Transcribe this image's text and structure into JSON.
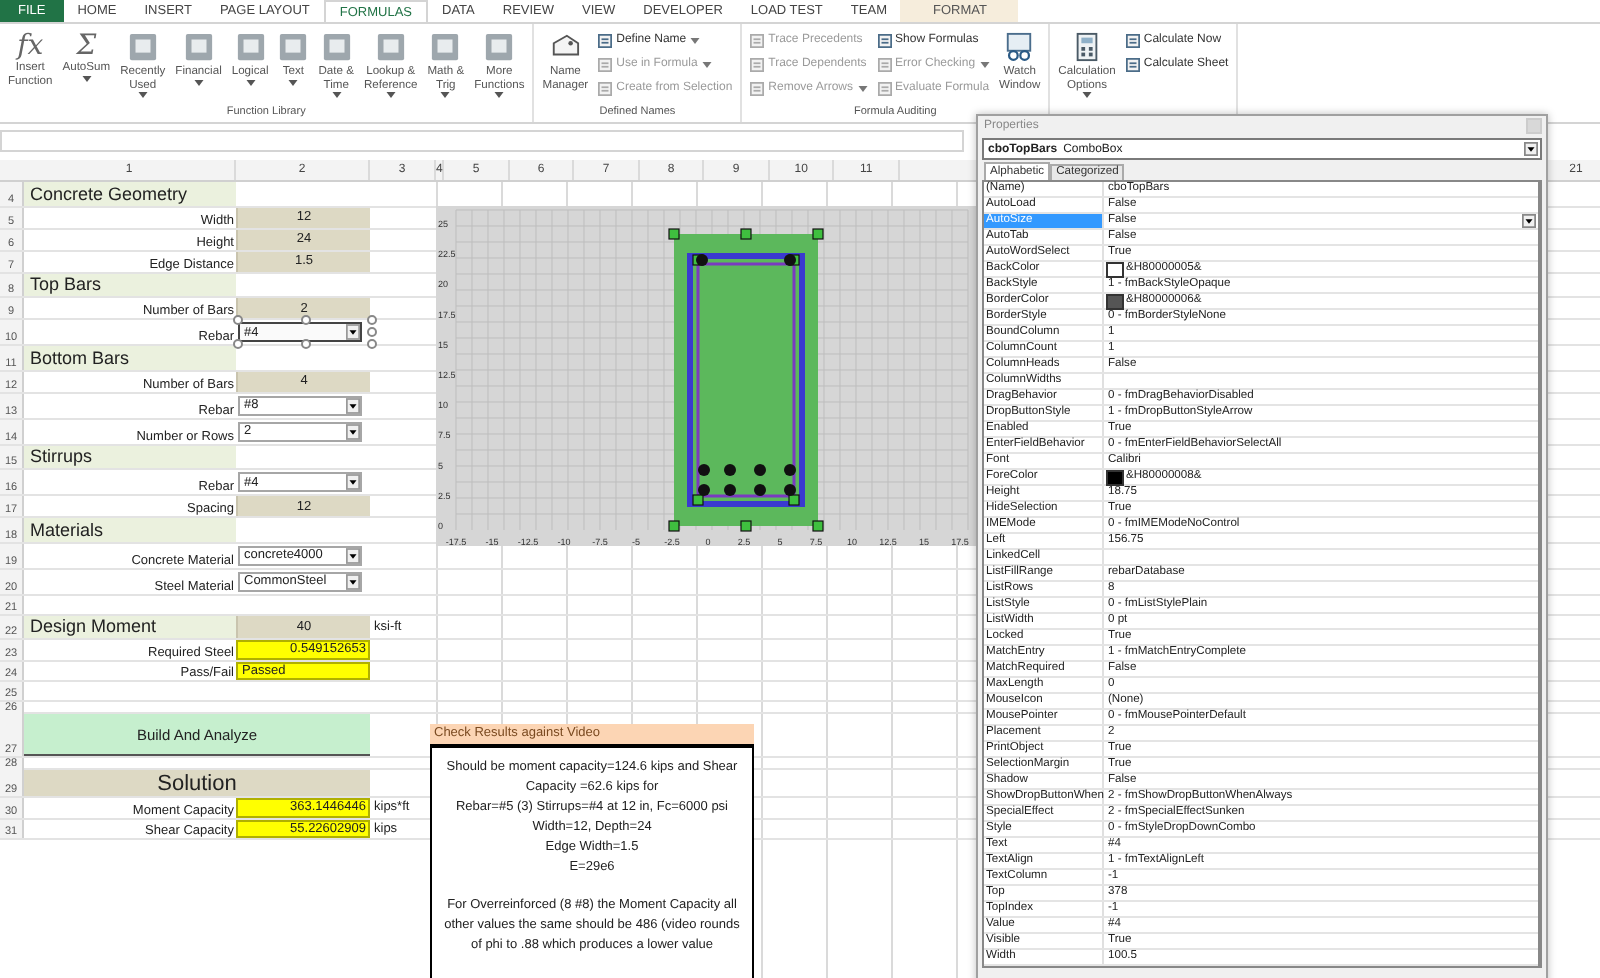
{
  "ribbon_tabs": [
    {
      "label": "FILE",
      "kind": "file",
      "selected": false
    },
    {
      "label": "HOME",
      "kind": "tab",
      "selected": false
    },
    {
      "label": "INSERT",
      "kind": "tab",
      "selected": false
    },
    {
      "label": "PAGE LAYOUT",
      "kind": "tab",
      "selected": false
    },
    {
      "label": "FORMULAS",
      "kind": "tab",
      "selected": true
    },
    {
      "label": "DATA",
      "kind": "tab",
      "selected": false
    },
    {
      "label": "REVIEW",
      "kind": "tab",
      "selected": false
    },
    {
      "label": "VIEW",
      "kind": "tab",
      "selected": false
    },
    {
      "label": "DEVELOPER",
      "kind": "tab",
      "selected": false
    },
    {
      "label": "LOAD TEST",
      "kind": "tab",
      "selected": false
    },
    {
      "label": "TEAM",
      "kind": "tab",
      "selected": false
    },
    {
      "label": "FORMAT",
      "kind": "contextual",
      "selected": false
    }
  ],
  "ribbon_groups": [
    {
      "label": "Function Library",
      "items": [
        {
          "kind": "large",
          "glyph": "fx",
          "lines": [
            "Insert",
            "Function"
          ],
          "dropdown": false
        },
        {
          "kind": "large",
          "glyph": "Σ",
          "lines": [
            "AutoSum"
          ],
          "dropdown": true
        },
        {
          "kind": "large",
          "lines": [
            "Recently",
            "Used"
          ],
          "dropdown": true
        },
        {
          "kind": "large",
          "lines": [
            "Financial"
          ],
          "dropdown": true
        },
        {
          "kind": "large",
          "lines": [
            "Logical"
          ],
          "dropdown": true
        },
        {
          "kind": "large",
          "lines": [
            "Text"
          ],
          "dropdown": true
        },
        {
          "kind": "large",
          "lines": [
            "Date &",
            "Time"
          ],
          "dropdown": true
        },
        {
          "kind": "large",
          "lines": [
            "Lookup &",
            "Reference"
          ],
          "dropdown": true
        },
        {
          "kind": "large",
          "lines": [
            "Math &",
            "Trig"
          ],
          "dropdown": true
        },
        {
          "kind": "large",
          "lines": [
            "More",
            "Functions"
          ],
          "dropdown": true
        }
      ]
    },
    {
      "label": "Defined Names",
      "items": [
        {
          "kind": "large",
          "lines": [
            "Name",
            "Manager"
          ],
          "dropdown": false
        },
        {
          "kind": "stack",
          "buttons": [
            {
              "label": "Define Name",
              "dropdown": true,
              "disabled": false
            },
            {
              "label": "Use in Formula",
              "dropdown": true,
              "disabled": true
            },
            {
              "label": "Create from Selection",
              "dropdown": false,
              "disabled": true
            }
          ]
        }
      ]
    },
    {
      "label": "Formula Auditing",
      "items": [
        {
          "kind": "stack",
          "buttons": [
            {
              "label": "Trace Precedents",
              "dropdown": false,
              "disabled": true
            },
            {
              "label": "Trace Dependents",
              "dropdown": false,
              "disabled": true
            },
            {
              "label": "Remove Arrows",
              "dropdown": true,
              "disabled": true
            }
          ]
        },
        {
          "kind": "stack",
          "buttons": [
            {
              "label": "Show Formulas",
              "dropdown": false,
              "disabled": false
            },
            {
              "label": "Error Checking",
              "dropdown": true,
              "disabled": true
            },
            {
              "label": "Evaluate Formula",
              "dropdown": false,
              "disabled": true
            }
          ]
        },
        {
          "kind": "large",
          "lines": [
            "Watch",
            "Window"
          ],
          "dropdown": false
        }
      ]
    },
    {
      "items": [
        {
          "kind": "large",
          "lines": [
            "Calculation",
            "Options"
          ],
          "dropdown": true
        },
        {
          "kind": "stack",
          "buttons": [
            {
              "label": "Calculate Now",
              "dropdown": false,
              "disabled": false
            },
            {
              "label": "Calculate Sheet",
              "dropdown": false,
              "disabled": false
            }
          ]
        }
      ]
    }
  ],
  "column_headers": [
    "1",
    "2",
    "3",
    "4",
    "5",
    "6",
    "7",
    "8",
    "9",
    "10",
    "11"
  ],
  "far_column_header": "21",
  "sheet_rows": [
    {
      "row": "4",
      "kind": "section",
      "label": "Concrete Geometry"
    },
    {
      "row": "5",
      "kind": "value",
      "label": "Width",
      "value": "12"
    },
    {
      "row": "6",
      "kind": "value",
      "label": "Height",
      "value": "24"
    },
    {
      "row": "7",
      "kind": "value",
      "label": "Edge Distance",
      "value": "1.5"
    },
    {
      "row": "8",
      "kind": "section",
      "label": "Top Bars"
    },
    {
      "row": "9",
      "kind": "value",
      "label": "Number of Bars",
      "value": "2"
    },
    {
      "row": "10",
      "kind": "combo",
      "label": "Rebar",
      "value": "#4",
      "selected": true
    },
    {
      "row": "11",
      "kind": "section",
      "label": "Bottom Bars"
    },
    {
      "row": "12",
      "kind": "value",
      "label": "Number of Bars",
      "value": "4"
    },
    {
      "row": "13",
      "kind": "combo",
      "label": "Rebar",
      "value": "#8",
      "selected": false
    },
    {
      "row": "14",
      "kind": "combo",
      "label": "Number or Rows",
      "value": "2",
      "selected": false
    },
    {
      "row": "15",
      "kind": "section",
      "label": "Stirrups"
    },
    {
      "row": "16",
      "kind": "combo",
      "label": "Rebar",
      "value": "#4",
      "selected": false
    },
    {
      "row": "17",
      "kind": "value",
      "label": "Spacing",
      "value": "12"
    },
    {
      "row": "18",
      "kind": "section",
      "label": "Materials"
    },
    {
      "row": "19",
      "kind": "combo",
      "label": "Concrete Material",
      "value": "concrete4000",
      "selected": false
    },
    {
      "row": "20",
      "kind": "combo",
      "label": "Steel Material",
      "value": "CommonSteel",
      "selected": false
    },
    {
      "row": "21",
      "kind": "blank"
    },
    {
      "row": "22",
      "kind": "heading_value",
      "label": "Design Moment",
      "value": "40",
      "unit": "ksi-ft"
    },
    {
      "row": "23",
      "kind": "result",
      "label": "Required Steel",
      "value": "0.549152653"
    },
    {
      "row": "24",
      "kind": "result_text",
      "label": "Pass/Fail",
      "value": "Passed"
    },
    {
      "row": "25",
      "kind": "blank"
    },
    {
      "row": "26",
      "kind": "spacer"
    },
    {
      "row": "27",
      "kind": "button",
      "label": "Build And Analyze"
    },
    {
      "row": "28",
      "kind": "spacer"
    },
    {
      "row": "29",
      "kind": "solution",
      "label": "Solution"
    },
    {
      "row": "30",
      "kind": "result",
      "label": "Moment Capacity",
      "value": "363.1446446",
      "unit": "kips*ft"
    },
    {
      "row": "31",
      "kind": "result",
      "label": "Shear Capacity",
      "value": "55.22602909",
      "unit": "kips"
    }
  ],
  "section_drawing": {
    "y_labels": [
      "25",
      "22.5",
      "20",
      "17.5",
      "15",
      "12.5",
      "10",
      "7.5",
      "5",
      "2.5",
      "0"
    ],
    "x_labels": [
      "-17.5",
      "-15",
      "-12.5",
      "-10",
      "-7.5",
      "-5",
      "-2.5",
      "0",
      "2.5",
      "5",
      "7.5",
      "10",
      "12.5",
      "15",
      "17.5"
    ]
  },
  "check_box": {
    "title": "Check Results against Video",
    "blocks": [
      [
        "Should be moment capacity=124.6  kips and Shear Capacity =62.6 kips  for",
        "Rebar=#5 (3)  Stirrups=#4 at 12 in, Fc=6000 psi",
        "Width=12, Depth=24",
        "Edge Width=1.5",
        "E=29e6"
      ],
      [
        "For Overreinforced  (8 #8) the  Moment Capacity all other values the same  should be 486 (video rounds of phi to .88 which produces a lower value"
      ]
    ]
  },
  "properties": {
    "title": "Properties",
    "object_name": "cboTopBars",
    "object_type": "ComboBox",
    "tabs": [
      {
        "label": "Alphabetic",
        "selected": true
      },
      {
        "label": "Categorized",
        "selected": false
      }
    ],
    "rows": [
      {
        "name": "(Name)",
        "value": "cboTopBars",
        "selected": false
      },
      {
        "name": "AutoLoad",
        "value": "False",
        "selected": false
      },
      {
        "name": "AutoSize",
        "value": "False",
        "selected": true
      },
      {
        "name": "AutoTab",
        "value": "False",
        "selected": false
      },
      {
        "name": "AutoWordSelect",
        "value": "True",
        "selected": false
      },
      {
        "name": "BackColor",
        "value": "&H80000005&",
        "color": "#ffffff",
        "selected": false
      },
      {
        "name": "BackStyle",
        "value": "1 - fmBackStyleOpaque",
        "selected": false
      },
      {
        "name": "BorderColor",
        "value": "&H80000006&",
        "color": "#555555",
        "selected": false
      },
      {
        "name": "BorderStyle",
        "value": "0 - fmBorderStyleNone",
        "selected": false
      },
      {
        "name": "BoundColumn",
        "value": "1",
        "selected": false
      },
      {
        "name": "ColumnCount",
        "value": "1",
        "selected": false
      },
      {
        "name": "ColumnHeads",
        "value": "False",
        "selected": false
      },
      {
        "name": "ColumnWidths",
        "selected": false
      },
      {
        "name": "DragBehavior",
        "value": "0 - fmDragBehaviorDisabled",
        "selected": false
      },
      {
        "name": "DropButtonStyle",
        "value": "1 - fmDropButtonStyleArrow",
        "selected": false
      },
      {
        "name": "Enabled",
        "value": "True",
        "selected": false
      },
      {
        "name": "EnterFieldBehavior",
        "value": "0 - fmEnterFieldBehaviorSelectAll",
        "selected": false
      },
      {
        "name": "Font",
        "value": "Calibri",
        "selected": false
      },
      {
        "name": "ForeColor",
        "value": "&H80000008&",
        "color": "#000000",
        "selected": false
      },
      {
        "name": "Height",
        "value": "18.75",
        "selected": false
      },
      {
        "name": "HideSelection",
        "value": "True",
        "selected": false
      },
      {
        "name": "IMEMode",
        "value": "0 - fmIMEModeNoControl",
        "selected": false
      },
      {
        "name": "Left",
        "value": "156.75",
        "selected": false
      },
      {
        "name": "LinkedCell",
        "selected": false
      },
      {
        "name": "ListFillRange",
        "value": "rebarDatabase",
        "selected": false
      },
      {
        "name": "ListRows",
        "value": "8",
        "selected": false
      },
      {
        "name": "ListStyle",
        "value": "0 - fmListStylePlain",
        "selected": false
      },
      {
        "name": "ListWidth",
        "value": "0 pt",
        "selected": false
      },
      {
        "name": "Locked",
        "value": "True",
        "selected": false
      },
      {
        "name": "MatchEntry",
        "value": "1 - fmMatchEntryComplete",
        "selected": false
      },
      {
        "name": "MatchRequired",
        "value": "False",
        "selected": false
      },
      {
        "name": "MaxLength",
        "value": "0",
        "selected": false
      },
      {
        "name": "MouseIcon",
        "value": "(None)",
        "selected": false
      },
      {
        "name": "MousePointer",
        "value": "0 - fmMousePointerDefault",
        "selected": false
      },
      {
        "name": "Placement",
        "value": "2",
        "selected": false
      },
      {
        "name": "PrintObject",
        "value": "True",
        "selected": false
      },
      {
        "name": "SelectionMargin",
        "value": "True",
        "selected": false
      },
      {
        "name": "Shadow",
        "value": "False",
        "selected": false
      },
      {
        "name": "ShowDropButtonWhen",
        "value": "2 - fmShowDropButtonWhenAlways",
        "selected": false
      },
      {
        "name": "SpecialEffect",
        "value": "2 - fmSpecialEffectSunken",
        "selected": false
      },
      {
        "name": "Style",
        "value": "0 - fmStyleDropDownCombo",
        "selected": false
      },
      {
        "name": "Text",
        "value": "#4",
        "selected": false
      },
      {
        "name": "TextAlign",
        "value": "1 - fmTextAlignLeft",
        "selected": false
      },
      {
        "name": "TextColumn",
        "value": "-1",
        "selected": false
      },
      {
        "name": "Top",
        "value": "378",
        "selected": false
      },
      {
        "name": "TopIndex",
        "value": "-1",
        "selected": false
      },
      {
        "name": "Value",
        "value": "#4",
        "selected": false
      },
      {
        "name": "Visible",
        "value": "True",
        "selected": false
      },
      {
        "name": "Width",
        "value": "100.5",
        "selected": false
      }
    ]
  }
}
